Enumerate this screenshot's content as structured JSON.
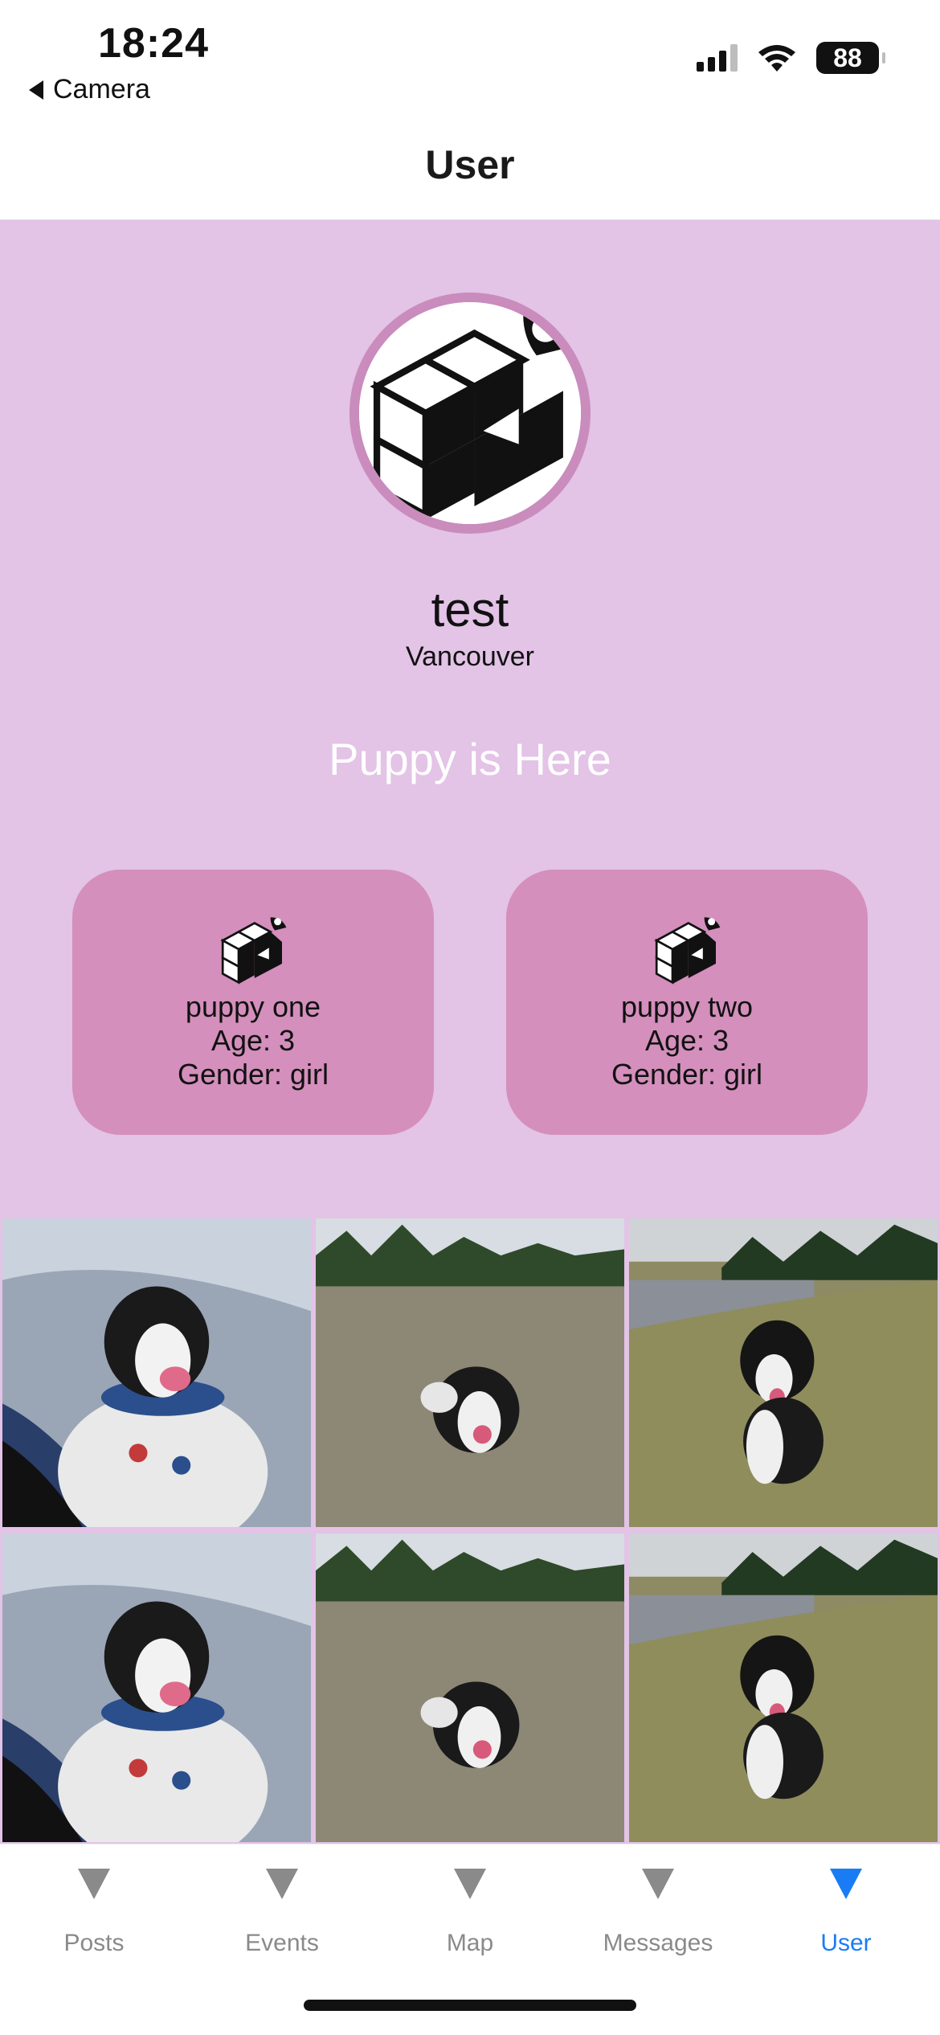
{
  "status_bar": {
    "time": "18:24",
    "back_label": "Camera",
    "battery": "88"
  },
  "header": {
    "title": "User"
  },
  "profile": {
    "name": "test",
    "city": "Vancouver",
    "headline": "Puppy is Here"
  },
  "pets": [
    {
      "name": "puppy one",
      "age": "Age: 3",
      "gender": "Gender: girl"
    },
    {
      "name": "puppy two",
      "age": "Age: 3",
      "gender": "Gender: girl"
    }
  ],
  "tabs": [
    {
      "label": "Posts",
      "icon": "triangle-down-icon"
    },
    {
      "label": "Events",
      "icon": "triangle-down-icon"
    },
    {
      "label": "Map",
      "icon": "triangle-down-icon"
    },
    {
      "label": "Messages",
      "icon": "triangle-down-icon"
    },
    {
      "label": "User",
      "icon": "triangle-down-icon",
      "active": true
    }
  ],
  "colors": {
    "profile_background": "#e3c3e6",
    "card_background": "#d48fbc",
    "active_tab": "#1a7cf5",
    "inactive_tab": "#8a8a8a"
  }
}
